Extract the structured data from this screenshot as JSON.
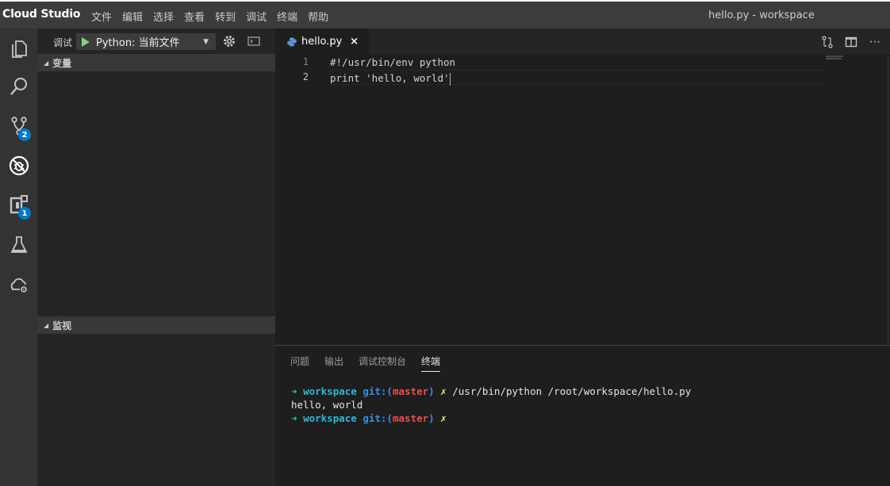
{
  "titlebar": {
    "brand": "Cloud Studio",
    "menu": [
      "文件",
      "编辑",
      "选择",
      "查看",
      "转到",
      "调试",
      "终端",
      "帮助"
    ],
    "window_title": "hello.py - workspace"
  },
  "activity_bar": {
    "items": [
      {
        "icon": "explorer-icon"
      },
      {
        "icon": "search-icon"
      },
      {
        "icon": "source-control-icon",
        "badge": "2"
      },
      {
        "icon": "debug-icon"
      },
      {
        "icon": "extensions-icon",
        "badge": "1"
      },
      {
        "icon": "flask-icon"
      },
      {
        "icon": "cloud-settings-icon"
      }
    ]
  },
  "debug": {
    "label": "调试",
    "configuration": "Python: 当前文件",
    "sections": {
      "variables": "变量",
      "watch": "监视"
    }
  },
  "editor": {
    "tab": {
      "label": "hello.py",
      "close": "×"
    },
    "lines": [
      {
        "number": "1",
        "text": "#!/usr/bin/env python"
      },
      {
        "number": "2",
        "text": "print 'hello, world'"
      }
    ]
  },
  "panel": {
    "tabs": [
      "问题",
      "输出",
      "调试控制台",
      "终端"
    ],
    "active_tab": "终端",
    "terminal": {
      "arrow": "➜",
      "dir": "workspace",
      "git_prefix": "git:(",
      "branch": "master",
      "git_suffix": ")",
      "dirty_mark": "✗",
      "command": "/usr/bin/python /root/workspace/hello.py",
      "output": "hello, world"
    }
  },
  "colors": {
    "accent": "#007acc",
    "play": "#89d185",
    "terminal_green": "#23d18b",
    "terminal_cyan": "#29b8db",
    "terminal_red": "#f14c4c",
    "terminal_yellow": "#f5f543"
  }
}
